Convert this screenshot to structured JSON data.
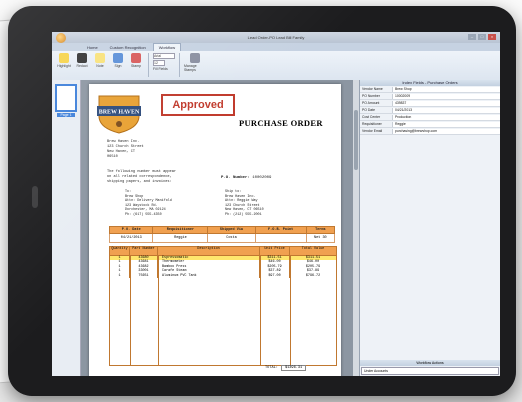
{
  "window": {
    "title": "Lead Order-PO Lead Bill Family"
  },
  "tabs": [
    "Home",
    "Custom Recognition",
    "Workflow"
  ],
  "active_tab": 2,
  "ribbon": {
    "buttons": [
      "Highlight",
      "Redact",
      "Note",
      "Sign",
      "Stamp"
    ],
    "font": "Arial",
    "size": "12",
    "fill_text": "Fill Fields",
    "manage": "Manage Stamps"
  },
  "document": {
    "logo": "BREW HAVEN",
    "stamp": "Approved",
    "heading": "PURCHASE ORDER",
    "company": [
      "Brew Haven Inc.",
      "123 Church Street",
      "New Haven, CT",
      "06510"
    ],
    "notice": [
      "The following number must appear",
      "on all related correspondence,",
      "shipping papers, and invoices:"
    ],
    "po_number_label": "P.O. Number:",
    "po_number": "10002009",
    "vendor": [
      "To:",
      "Brew Shop",
      "Attn: Delivery Manifold",
      "123 Waystock Rd.",
      "Dorchester, MA 02124",
      "Ph: (617) 555-4350"
    ],
    "shipto": [
      "Ship to:",
      "Brew Haven Inc.",
      "Attn: Reggie Way",
      "123 Church Street",
      "New Haven, CT 06510",
      "Ph: (212) 555-2001"
    ],
    "ship_headers": [
      "P.O. Date",
      "Requisitioner",
      "Shipped Via",
      "F.O.B. Point",
      "Terms"
    ],
    "ship_values": [
      "04/21/2013",
      "Reggie",
      "Costa",
      "",
      "Net 30"
    ],
    "item_headers": [
      "Quantity",
      "Part Number",
      "Description",
      "Unit Price",
      "Total Value"
    ],
    "items": [
      [
        "1",
        "43680",
        "Espressomatic",
        "$311.51",
        "$311.51"
      ],
      [
        "1",
        "43681",
        "Thermometer",
        "$46.00",
        "$46.00"
      ],
      [
        "1",
        "43682",
        "Bamboo Press",
        "$205.79",
        "$205.79"
      ],
      [
        "1",
        "33001",
        "Carafe Steam",
        "$37.89",
        "$37.89"
      ],
      [
        "1",
        "75651",
        "Aluminum PVC Tank",
        "$97.00",
        "$796.72"
      ]
    ],
    "total_label": "TOTAL:",
    "total_value": "$1396.31"
  },
  "thumbnail_label": "Page 1",
  "panel": {
    "title": "Index Fields - Purchase Orders",
    "fields": [
      [
        "Vendor Name",
        "Brew Shop"
      ],
      [
        "PO Number",
        "10002009"
      ],
      [
        "PO Amount",
        "439837"
      ],
      [
        "PO Date",
        "04/21/2013"
      ],
      [
        "Cost Center",
        "Production"
      ],
      [
        "Requisitioner",
        "Reggie"
      ],
      [
        "Vendor Email",
        "purchasing@brewshop.com"
      ]
    ],
    "bottom_title": "Workflow Actions",
    "bottom_select": "Under Accounts"
  },
  "colors": {
    "accent": "#f0a050",
    "stamp": "#c0392b",
    "selection": "#ffe66d"
  }
}
